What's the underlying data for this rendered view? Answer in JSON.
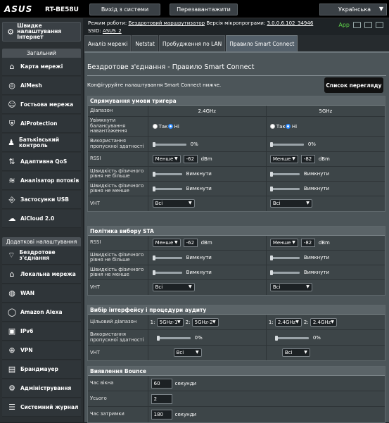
{
  "header": {
    "logo": "ASUS",
    "model": "RT-BE58U",
    "logout": "Вихід з системи",
    "reboot": "Перезавантажити",
    "language": "Українська"
  },
  "info": {
    "mode_label": "Режим роботи:",
    "mode_value": "Бездротовий маршрутизатор",
    "fw_label": "Версія мікропрограми:",
    "fw_value": "3.0.0.6.102_34946",
    "ssid_label": "SSID:",
    "ssid_value": "ASUS_2",
    "app_label": "App"
  },
  "sidebar": {
    "quick": "Швидке налаштування Інтернет",
    "general_header": "Загальний",
    "general": [
      {
        "label": "Карта мережі",
        "icon": "network-map-icon"
      },
      {
        "label": "AiMesh",
        "icon": "aimesh-icon"
      },
      {
        "label": "Гостьова мережа",
        "icon": "guest-network-icon"
      },
      {
        "label": "AiProtection",
        "icon": "shield-icon"
      },
      {
        "label": "Батьківський контроль",
        "icon": "parental-icon"
      },
      {
        "label": "Адаптивна QoS",
        "icon": "qos-icon"
      },
      {
        "label": "Аналізатор потоків",
        "icon": "traffic-icon"
      },
      {
        "label": "Застосунки USB",
        "icon": "usb-icon"
      },
      {
        "label": "AiCloud 2.0",
        "icon": "cloud-icon"
      }
    ],
    "advanced_header": "Додаткові налаштування",
    "advanced": [
      {
        "label": "Бездротове з'єднання",
        "icon": "wireless-icon"
      },
      {
        "label": "Локальна мережа",
        "icon": "lan-icon"
      },
      {
        "label": "WAN",
        "icon": "globe-icon"
      },
      {
        "label": "Amazon Alexa",
        "icon": "alexa-icon"
      },
      {
        "label": "IPv6",
        "icon": "ipv6-icon"
      },
      {
        "label": "VPN",
        "icon": "vpn-icon"
      },
      {
        "label": "Брандмауер",
        "icon": "firewall-icon"
      },
      {
        "label": "Адміністрування",
        "icon": "admin-icon"
      },
      {
        "label": "Системний журнал",
        "icon": "log-icon"
      }
    ]
  },
  "tabs": [
    "Аналіз мережі",
    "Netstat",
    "Пробудження по LAN",
    "Правило Smart Connect"
  ],
  "page": {
    "title": "Бездротове з'єднання - Правило Smart Connect",
    "desc": "Конфігуруйте налаштування Smart Connect нижче.",
    "view_list": "Список перегляду"
  },
  "trigger": {
    "header": "Спрямування умови тригера",
    "col0": "Діапазон",
    "band1": "2.4GHz",
    "band2": "5GHz",
    "load_label": "Увімкнути балансування навантаження",
    "yes": "Так",
    "no": "Ні",
    "bw_label": "Використання пропускної здатності",
    "bw1": "0%",
    "bw2": "0%",
    "rssi_label": "RSSI",
    "rssi_op1": "Менше",
    "rssi_val1": "-62",
    "rssi_op2": "Менше",
    "rssi_val2": "-82",
    "dbm": "dBm",
    "phy_gt_label": "Швидкість фізичного рівня не більше",
    "phy_lt_label": "Швидкість фізичного рівня не менше",
    "off": "Вимкнути",
    "vht_label": "VHT",
    "vht1": "Всі",
    "vht2": "Всі"
  },
  "sta": {
    "header": "Політика вибору STA",
    "rssi_label": "RSSI",
    "rssi_op1": "Менше",
    "rssi_val1": "-62",
    "rssi_op2": "Менше",
    "rssi_val2": "-82",
    "dbm": "dBm",
    "phy_gt_label": "Швидкість фізичного рівня не більше",
    "phy_lt_label": "Швидкість фізичного рівня не менше",
    "off": "Вимкнути",
    "vht_label": "VHT",
    "vht1": "Всі",
    "vht2": "Всі"
  },
  "iface": {
    "header": "Вибір інтерфейсу і процедури аудиту",
    "target_label": "Цільовий діапазон",
    "n1": "1:",
    "n2": "2:",
    "a1": "5GHz-1",
    "a2": "5GHz-2",
    "b1": "2.4GHz",
    "b2": "2.4GHz",
    "bw_label": "Використання пропускної здатності",
    "bw1": "0%",
    "bw2": "0%",
    "vht_label": "VHT",
    "vht1": "Всі",
    "vht2": "Всі"
  },
  "bounce": {
    "header": "Виявлення Bounce",
    "window_label": "Час вікна",
    "window_val": "60",
    "sec": "секунди",
    "count_label": "Усього",
    "count_val": "2",
    "delay_label": "Час затримки",
    "delay_val": "180"
  }
}
